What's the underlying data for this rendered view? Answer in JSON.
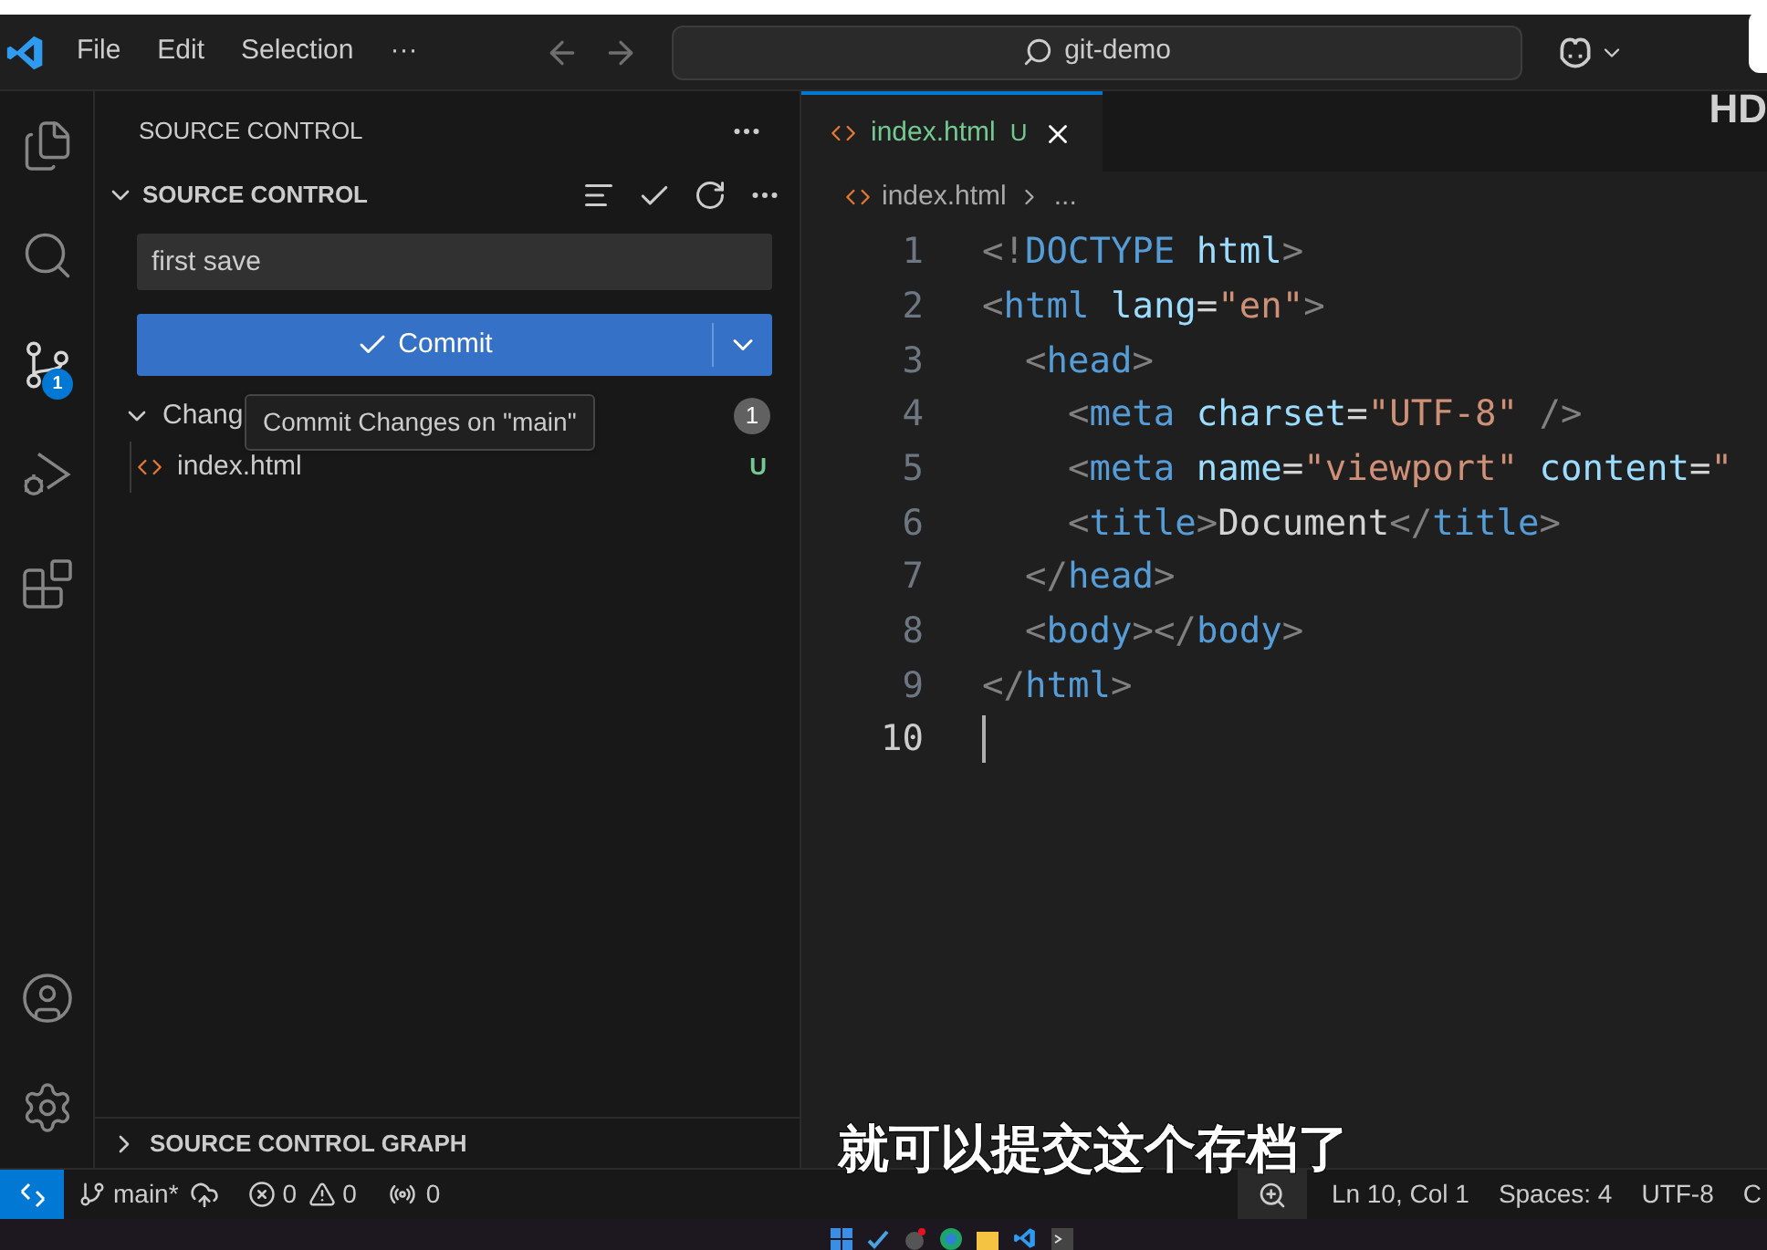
{
  "title_bar": {
    "menu": [
      "File",
      "Edit",
      "Selection",
      "···"
    ],
    "search": "git-demo"
  },
  "activity_bar": {
    "items": [
      {
        "kind": "files",
        "selected": false
      },
      {
        "kind": "search",
        "selected": false
      },
      {
        "kind": "source_control",
        "selected": true,
        "badge": "1"
      },
      {
        "kind": "run",
        "selected": false
      },
      {
        "kind": "extensions",
        "selected": false
      }
    ],
    "bottom": [
      {
        "kind": "account"
      },
      {
        "kind": "settings"
      }
    ]
  },
  "sidebar": {
    "title": "SOURCE CONTROL",
    "section": {
      "title": "SOURCE CONTROL",
      "expanded": true
    },
    "commit_message": "first save",
    "commit_button": "Commit",
    "tooltip": "Commit Changes on \"main\"",
    "changes": {
      "label": "Chang",
      "count": "1",
      "expanded": true,
      "files": [
        {
          "name": "index.html",
          "status": "U"
        }
      ]
    },
    "graph": {
      "title": "SOURCE CONTROL GRAPH",
      "expanded": false
    }
  },
  "editor": {
    "tabs": [
      {
        "label": "index.html",
        "status": "U",
        "selected": true
      }
    ],
    "breadcrumb": [
      "index.html",
      "..."
    ],
    "lines": [
      {
        "number": "1",
        "active": false,
        "tokens": [
          {
            "kind": "punct",
            "text": "<!"
          },
          {
            "kind": "tag",
            "text": "DOCTYPE"
          },
          {
            "kind": "attr",
            "text": " html"
          },
          {
            "kind": "punct",
            "text": ">"
          }
        ]
      },
      {
        "number": "2",
        "active": false,
        "tokens": [
          {
            "kind": "punct",
            "text": "<"
          },
          {
            "kind": "tag",
            "text": "html"
          },
          {
            "kind": "attr",
            "text": " lang"
          },
          {
            "kind": "text",
            "text": "="
          },
          {
            "kind": "string",
            "text": "\"en\""
          },
          {
            "kind": "punct",
            "text": ">"
          }
        ]
      },
      {
        "number": "3",
        "active": false,
        "tokens": [
          {
            "kind": "punct",
            "text": "  <"
          },
          {
            "kind": "tag",
            "text": "head"
          },
          {
            "kind": "punct",
            "text": ">"
          }
        ]
      },
      {
        "number": "4",
        "active": false,
        "tokens": [
          {
            "kind": "punct",
            "text": "    <"
          },
          {
            "kind": "tag",
            "text": "meta"
          },
          {
            "kind": "attr",
            "text": " charset"
          },
          {
            "kind": "text",
            "text": "="
          },
          {
            "kind": "string",
            "text": "\"UTF-8\""
          },
          {
            "kind": "punct",
            "text": " />"
          }
        ]
      },
      {
        "number": "5",
        "active": false,
        "tokens": [
          {
            "kind": "punct",
            "text": "    <"
          },
          {
            "kind": "tag",
            "text": "meta"
          },
          {
            "kind": "attr",
            "text": " name"
          },
          {
            "kind": "text",
            "text": "="
          },
          {
            "kind": "string",
            "text": "\"viewport\""
          },
          {
            "kind": "attr",
            "text": " content"
          },
          {
            "kind": "text",
            "text": "="
          },
          {
            "kind": "string",
            "text": "\""
          }
        ]
      },
      {
        "number": "6",
        "active": false,
        "tokens": [
          {
            "kind": "punct",
            "text": "    <"
          },
          {
            "kind": "tag",
            "text": "title"
          },
          {
            "kind": "punct",
            "text": ">"
          },
          {
            "kind": "text",
            "text": "Document"
          },
          {
            "kind": "punct",
            "text": "</"
          },
          {
            "kind": "tag",
            "text": "title"
          },
          {
            "kind": "punct",
            "text": ">"
          }
        ]
      },
      {
        "number": "7",
        "active": false,
        "tokens": [
          {
            "kind": "punct",
            "text": "  </"
          },
          {
            "kind": "tag",
            "text": "head"
          },
          {
            "kind": "punct",
            "text": ">"
          }
        ]
      },
      {
        "number": "8",
        "active": false,
        "tokens": [
          {
            "kind": "punct",
            "text": "  <"
          },
          {
            "kind": "tag",
            "text": "body"
          },
          {
            "kind": "punct",
            "text": "></"
          },
          {
            "kind": "tag",
            "text": "body"
          },
          {
            "kind": "punct",
            "text": ">"
          }
        ]
      },
      {
        "number": "9",
        "active": false,
        "tokens": [
          {
            "kind": "punct",
            "text": "</"
          },
          {
            "kind": "tag",
            "text": "html"
          },
          {
            "kind": "punct",
            "text": ">"
          }
        ]
      },
      {
        "number": "10",
        "active": true
      }
    ]
  },
  "status_bar": {
    "branch": "main*",
    "errors": "0",
    "warnings": "0",
    "ports": "0",
    "items": [
      "Ln 10, Col 1",
      "Spaces: 4",
      "UTF-8",
      "C"
    ]
  },
  "video_overlay": {
    "badge": "HD",
    "subtitle": "就可以提交这个存档了"
  }
}
